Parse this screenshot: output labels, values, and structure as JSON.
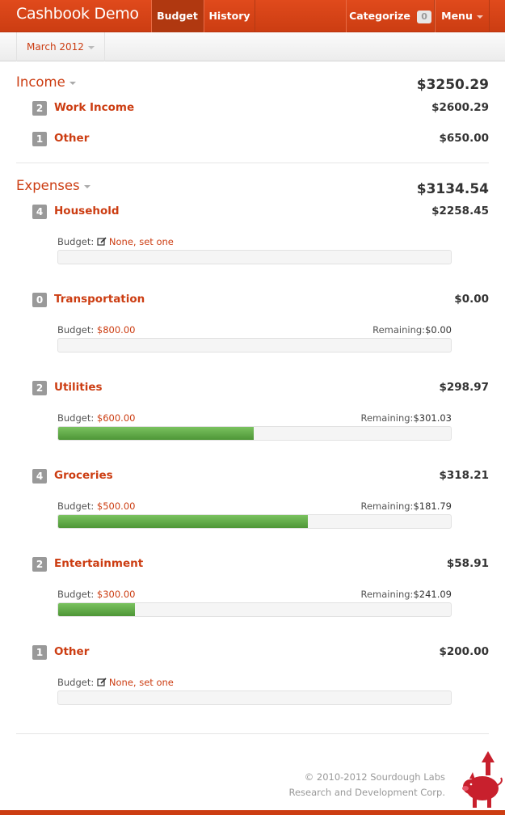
{
  "app": {
    "title": "Cashbook Demo"
  },
  "nav": {
    "budget": "Budget",
    "history": "History",
    "categorize": "Categorize",
    "categorize_count": "0",
    "menu": "Menu"
  },
  "period": {
    "label": "March 2012"
  },
  "income": {
    "title": "Income",
    "total": "$3250.29",
    "categories": [
      {
        "count": "2",
        "name": "Work Income",
        "amount": "$2600.29"
      },
      {
        "count": "1",
        "name": "Other",
        "amount": "$650.00"
      }
    ]
  },
  "expenses": {
    "title": "Expenses",
    "total": "$3134.54",
    "budget_label": "Budget:",
    "remaining_label": "Remaining:",
    "none_label": "None, set one",
    "categories": [
      {
        "count": "4",
        "name": "Household",
        "amount": "$2258.45",
        "budget": null,
        "remaining": null,
        "progress": 0
      },
      {
        "count": "0",
        "name": "Transportation",
        "amount": "$0.00",
        "budget": "$800.00",
        "remaining": "$0.00",
        "progress": 0
      },
      {
        "count": "2",
        "name": "Utilities",
        "amount": "$298.97",
        "budget": "$600.00",
        "remaining": "$301.03",
        "progress": 0.498
      },
      {
        "count": "4",
        "name": "Groceries",
        "amount": "$318.21",
        "budget": "$500.00",
        "remaining": "$181.79",
        "progress": 0.636
      },
      {
        "count": "2",
        "name": "Entertainment",
        "amount": "$58.91",
        "budget": "$300.00",
        "remaining": "$241.09",
        "progress": 0.196
      },
      {
        "count": "1",
        "name": "Other",
        "amount": "$200.00",
        "budget": null,
        "remaining": null,
        "progress": 0
      }
    ]
  },
  "footer": {
    "line1": "© 2010-2012 Sourdough Labs",
    "line2": "Research and Development Corp."
  },
  "colors": {
    "brand": "#cc3d12",
    "progress": "#5aa642"
  },
  "icons": {
    "edit": "edit-icon",
    "logo": "pig-logo-icon"
  }
}
